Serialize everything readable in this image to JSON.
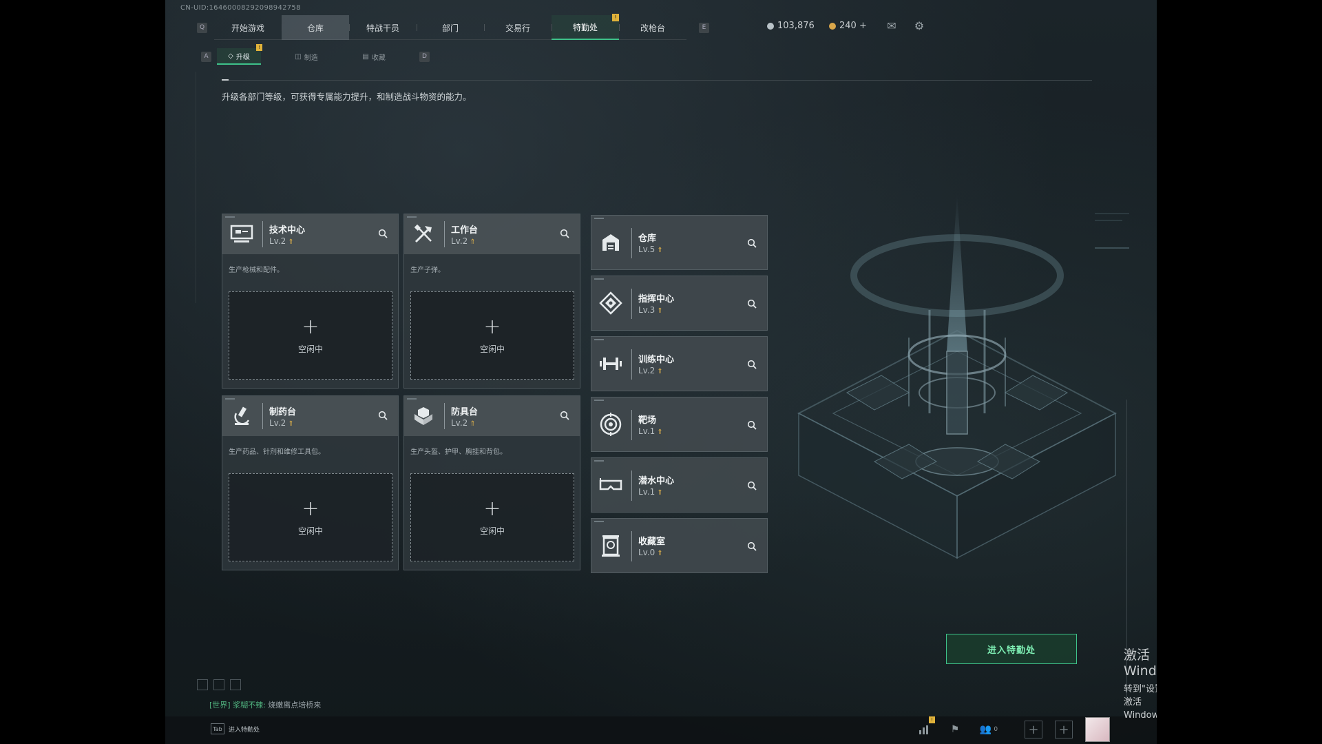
{
  "uid": "CN-UID:16460008292098942758",
  "nav": {
    "key_left": "Q",
    "key_right": "E",
    "tabs": [
      {
        "label": "开始游戏"
      },
      {
        "label": "仓库"
      },
      {
        "label": "特战干员"
      },
      {
        "label": "部门"
      },
      {
        "label": "交易行"
      },
      {
        "label": "特勤处",
        "notice": "!"
      },
      {
        "label": "改枪台"
      }
    ]
  },
  "currency": {
    "coins": "103,876",
    "tickets": "240 +"
  },
  "subnav": {
    "key_left": "A",
    "key_right": "D",
    "tabs": [
      {
        "label": "升级",
        "notice": "!"
      },
      {
        "label": "制造"
      },
      {
        "label": "收藏"
      }
    ]
  },
  "description": "升级各部门等级，可获得专属能力提升，和制造战斗物资的能力。",
  "production": [
    {
      "name": "技术中心",
      "level": "Lv.2",
      "desc": "生产枪械和配件。",
      "slot": "空闲中",
      "icon": "monitor-icon"
    },
    {
      "name": "工作台",
      "level": "Lv.2",
      "desc": "生产子弹。",
      "slot": "空闲中",
      "icon": "tools-icon"
    },
    {
      "name": "制药台",
      "level": "Lv.2",
      "desc": "生产药品、针剂和维修工具包。",
      "slot": "空闲中",
      "icon": "microscope-icon"
    },
    {
      "name": "防具台",
      "level": "Lv.2",
      "desc": "生产头盔、护甲、胸挂和背包。",
      "slot": "空闲中",
      "icon": "armor-icon"
    }
  ],
  "facilities": [
    {
      "name": "仓库",
      "level": "Lv.5",
      "icon": "warehouse-icon"
    },
    {
      "name": "指挥中心",
      "level": "Lv.3",
      "icon": "command-icon"
    },
    {
      "name": "训练中心",
      "level": "Lv.2",
      "icon": "dumbbell-icon"
    },
    {
      "name": "靶场",
      "level": "Lv.1",
      "icon": "target-icon"
    },
    {
      "name": "潜水中心",
      "level": "Lv.1",
      "icon": "goggles-icon"
    },
    {
      "name": "收藏室",
      "level": "Lv.0",
      "icon": "trophy-icon"
    }
  ],
  "enter_button": "进入特勤处",
  "chat": {
    "channel": "[世界]",
    "name": "浆糊不辣:",
    "message": "烧嫩离点培桥来"
  },
  "bottom": {
    "tab_key": "Tab",
    "tab_label": "进入特勤处",
    "friends_count": "0",
    "stats_notice": "!"
  },
  "watermark": {
    "line1": "激活 Windows",
    "line2": "转到\"设置\"以激活 Windows。"
  },
  "colors": {
    "accent": "#3ec28a",
    "notice": "#e0b23a",
    "level_arrow": "#e2b34a"
  }
}
